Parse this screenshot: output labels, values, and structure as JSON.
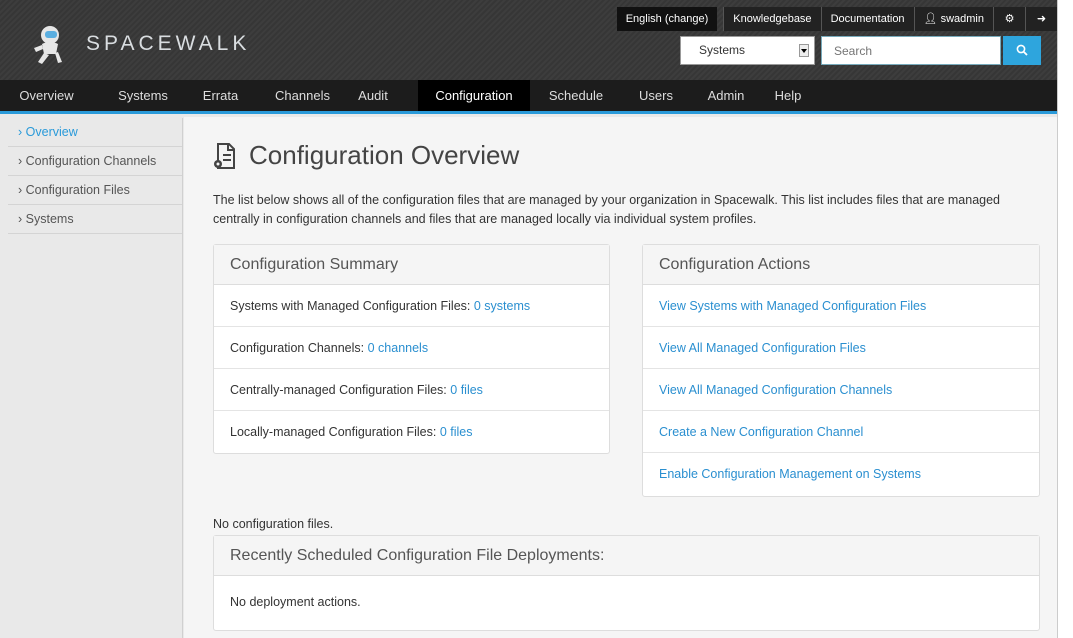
{
  "header": {
    "logo_text": "SPACEWALK",
    "top_links": {
      "language": "English (change)",
      "knowledgebase": "Knowledgebase",
      "documentation": "Documentation",
      "user": "swadmin"
    },
    "search": {
      "scope_value": "Systems",
      "placeholder": "Search"
    }
  },
  "nav": {
    "items": [
      "Overview",
      "Systems",
      "Errata",
      "Channels",
      "Audit",
      "Configuration",
      "Schedule",
      "Users",
      "Admin",
      "Help"
    ],
    "active": "Configuration"
  },
  "sidebar": {
    "items": [
      {
        "label": "Overview"
      },
      {
        "label": "Configuration Channels"
      },
      {
        "label": "Configuration Files"
      },
      {
        "label": "Systems"
      }
    ]
  },
  "main": {
    "title": "Configuration Overview",
    "intro": "The list below shows all of the configuration files that are managed by your organization in Spacewalk. This list includes files that are managed centrally in configuration channels and files that are managed locally via individual system profiles.",
    "summary": {
      "heading": "Configuration Summary",
      "rows": [
        {
          "label": "Systems with Managed Configuration Files:",
          "link": "0 systems"
        },
        {
          "label": "Configuration Channels:",
          "link": "0 channels"
        },
        {
          "label": "Centrally-managed Configuration Files:",
          "link": "0 files"
        },
        {
          "label": "Locally-managed Configuration Files:",
          "link": "0 files"
        }
      ]
    },
    "actions": {
      "heading": "Configuration Actions",
      "links": [
        "View Systems with Managed Configuration Files",
        "View All Managed Configuration Files",
        "View All Managed Configuration Channels",
        "Create a New Configuration Channel",
        "Enable Configuration Management on Systems"
      ]
    },
    "no_config": "No configuration files.",
    "deployments": {
      "heading": "Recently Scheduled Configuration File Deployments:",
      "empty": "No deployment actions."
    }
  },
  "colors": {
    "accent": "#2a9ad9",
    "link": "#2a8fd0",
    "nav_bg": "#1c1c1c"
  }
}
